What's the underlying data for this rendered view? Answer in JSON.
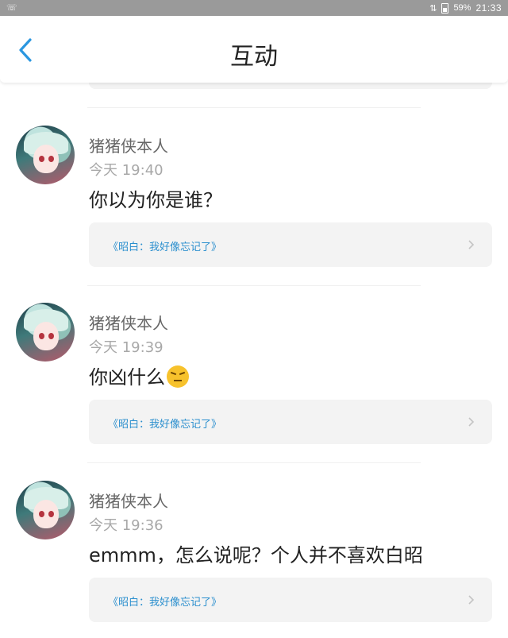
{
  "status_bar": {
    "left_icon": "notification-icon",
    "battery": "59%",
    "time": "21:33"
  },
  "header": {
    "title": "互动",
    "back_icon": "chevron-left-icon",
    "accent_color": "#2b97e0"
  },
  "comments": [
    {
      "author": "猪猪侠本人",
      "time": "今天 19:40",
      "content": "你以为你是谁？",
      "emoji": "",
      "source": "《昭白：我好像忘记了》"
    },
    {
      "author": "猪猪侠本人",
      "time": "今天 19:39",
      "content": "你凶什么",
      "emoji": "angry-face",
      "source": "《昭白：我好像忘记了》"
    },
    {
      "author": "猪猪侠本人",
      "time": "今天 19:36",
      "content": "emmm，怎么说呢？个人并不喜欢白昭",
      "emoji": "",
      "source": "《昭白：我好像忘记了》"
    }
  ],
  "colors": {
    "link": "#2b8fce",
    "card_bg": "#f3f3f3",
    "status_bar_bg": "#9a9a9a"
  }
}
